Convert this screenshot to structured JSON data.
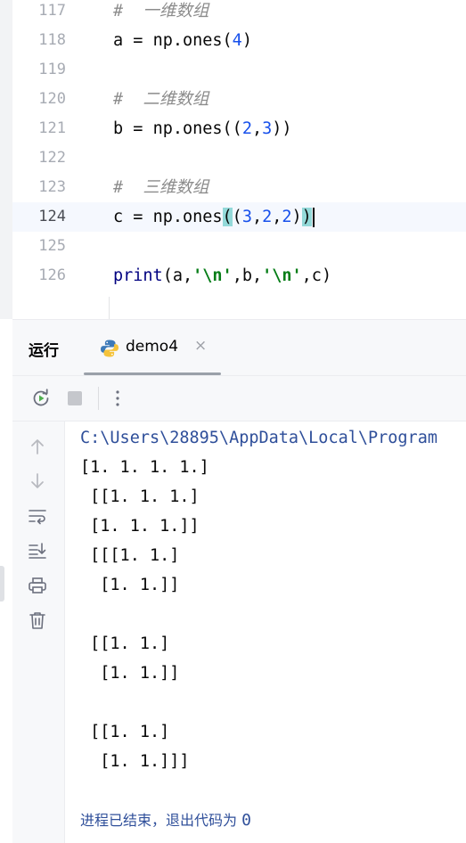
{
  "editor": {
    "lines": [
      {
        "number": "117",
        "comment_hash": "#",
        "comment_text": "一维数组"
      },
      {
        "number": "118",
        "var": "a",
        "op": "=",
        "call": "np.ones(",
        "arg1": "4",
        "close": ")"
      },
      {
        "number": "119"
      },
      {
        "number": "120",
        "comment_hash": "#",
        "comment_text": "二维数组"
      },
      {
        "number": "121",
        "var": "b",
        "op": "=",
        "call": "np.ones((",
        "arg1": "2",
        "comma1": ",",
        "arg2": "3",
        "close": "))"
      },
      {
        "number": "122"
      },
      {
        "number": "123",
        "comment_hash": "#",
        "comment_text": "三维数组"
      },
      {
        "number": "124",
        "var": "c",
        "op": "=",
        "call": "np.ones",
        "open_hl": "(",
        "open2": "(",
        "arg1": "3",
        "comma1": ",",
        "arg2": "2",
        "comma2": ",",
        "arg3": "2",
        "close1": ")",
        "close_hl": ")"
      },
      {
        "number": "125"
      },
      {
        "number": "126",
        "fn": "print",
        "open": "(",
        "a1": "a,",
        "s1": "'\\n'",
        "b1": ",b,",
        "s2": "'\\n'",
        "c1": ",c)"
      }
    ]
  },
  "run": {
    "title": "运行",
    "tab_label": "demo4",
    "tab_close": "×"
  },
  "console": {
    "path": "C:\\Users\\28895\\AppData\\Local\\Program",
    "output": [
      "[1. 1. 1. 1.]",
      " [[1. 1. 1.]",
      " [1. 1. 1.]]",
      " [[[1. 1.]",
      "  [1. 1.]]",
      "",
      " [[1. 1.]",
      "  [1. 1.]]",
      "",
      " [[1. 1.]",
      "  [1. 1.]]]"
    ],
    "exit_text": "进程已结束，退出代码为 ",
    "exit_code": "0"
  },
  "icons": {
    "rerun": "rerun-icon",
    "stop": "stop-icon",
    "more": "more-vertical-icon",
    "up": "arrow-up-icon",
    "down": "arrow-down-icon",
    "soft_wrap": "soft-wrap-icon",
    "scroll_end": "scroll-to-end-icon",
    "print": "print-icon",
    "trash": "trash-icon",
    "python": "python-icon"
  },
  "colors": {
    "keyword_number": "#1750eb",
    "string": "#067d17",
    "comment": "#8c8c8c",
    "bracket_match": "#93d9d9",
    "console_path": "#2f4f9a"
  }
}
